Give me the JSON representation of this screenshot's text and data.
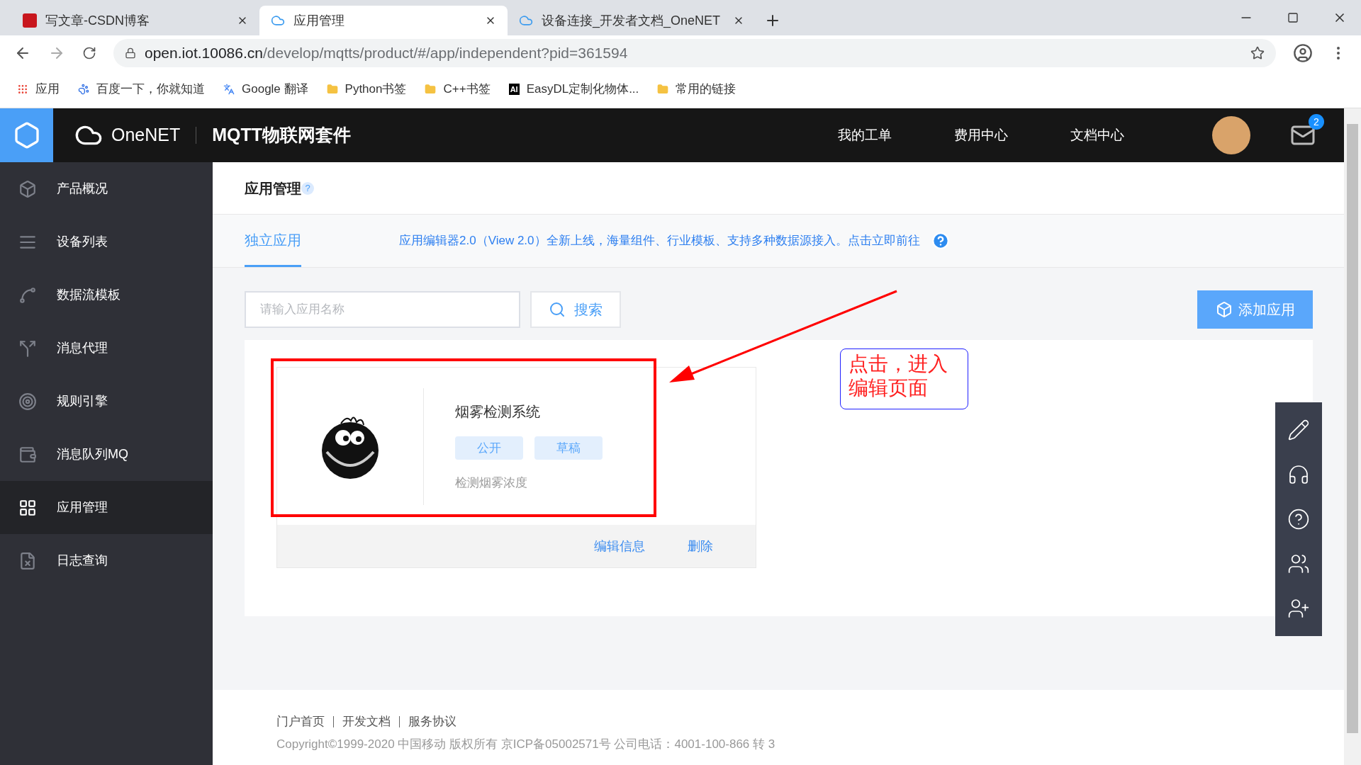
{
  "browser": {
    "tabs": [
      {
        "title": "写文章-CSDN博客",
        "kind": "logo",
        "selected": false
      },
      {
        "title": "应用管理",
        "kind": "cloud",
        "selected": true
      },
      {
        "title": "设备连接_开发者文档_OneNET",
        "kind": "cloud",
        "selected": false
      }
    ],
    "url_host": "open.iot.10086.cn",
    "url_path": "/develop/mqtts/product/#/app/independent?pid=361594",
    "bookmarks": [
      {
        "label": "应用",
        "kind": "apps"
      },
      {
        "label": "百度一下，你就知道",
        "kind": "paw"
      },
      {
        "label": "Google 翻译",
        "kind": "translate"
      },
      {
        "label": "Python书签",
        "kind": "folder"
      },
      {
        "label": "C++书签",
        "kind": "folder"
      },
      {
        "label": "EasyDL定制化物体...",
        "kind": "mark",
        "mark_text": "AI"
      },
      {
        "label": "常用的链接",
        "kind": "folder"
      }
    ]
  },
  "header": {
    "brand": "OneNET",
    "product": "MQTT物联网套件",
    "nav": [
      "我的工单",
      "费用中心",
      "文档中心"
    ],
    "mail_count": "2"
  },
  "sidebar": {
    "items": [
      {
        "label": "产品概况",
        "kind": "cube",
        "selected": false
      },
      {
        "label": "设备列表",
        "kind": "list",
        "selected": false
      },
      {
        "label": "数据流模板",
        "kind": "flow",
        "selected": false
      },
      {
        "label": "消息代理",
        "kind": "proxy",
        "selected": false
      },
      {
        "label": "规则引擎",
        "kind": "engine",
        "selected": false
      },
      {
        "label": "消息队列MQ",
        "kind": "queue",
        "selected": false
      },
      {
        "label": "应用管理",
        "kind": "grid",
        "selected": true
      },
      {
        "label": "日志查询",
        "kind": "log",
        "selected": false
      }
    ]
  },
  "page": {
    "title": "应用管理",
    "help": "?",
    "tabs": [
      {
        "label": "独立应用",
        "selected": true
      }
    ],
    "notice": "应用编辑器2.0（View 2.0）全新上线，海量组件、行业模板、支持多种数据源接入。点击立即前往",
    "search": {
      "placeholder": "请输入应用名称",
      "button": "搜索"
    },
    "add_button": "添加应用",
    "apps": [
      {
        "name": "烟雾检测系统",
        "tags": [
          "公开",
          "草稿"
        ],
        "description": "检测烟雾浓度",
        "actions": [
          "编辑信息",
          "删除"
        ]
      }
    ]
  },
  "annotation": {
    "text": "点击，进入编辑页面"
  },
  "footer": {
    "links": [
      "门户首页",
      "开发文档",
      "服务协议"
    ],
    "copyright": "Copyright©1999-2020 中国移动 版权所有 京ICP备05002571号 公司电话：4001-100-866 转 3"
  }
}
